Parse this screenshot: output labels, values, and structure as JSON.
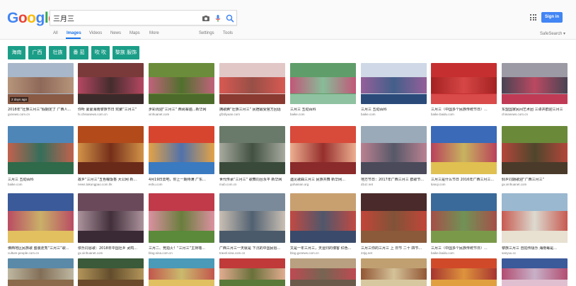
{
  "colors": {
    "brand_blue": "#4285f4",
    "tab_active": "#1a73e8",
    "chip_green": "#1b9e88"
  },
  "logo": {
    "letters": [
      {
        "ch": "G",
        "color": "#4285f4"
      },
      {
        "ch": "o",
        "color": "#ea4335"
      },
      {
        "ch": "o",
        "color": "#fbbc05"
      },
      {
        "ch": "g",
        "color": "#4285f4"
      },
      {
        "ch": "l",
        "color": "#34a853"
      },
      {
        "ch": "e",
        "color": "#ea4335"
      }
    ]
  },
  "search": {
    "value": "三月三",
    "icons": [
      "camera-icon",
      "mic-icon",
      "search-icon"
    ]
  },
  "header": {
    "apps_icon": "apps-grid-icon",
    "signin_label": "Sign in"
  },
  "tabs": [
    {
      "label": "All",
      "active": false
    },
    {
      "label": "Images",
      "active": true
    },
    {
      "label": "Videos",
      "active": false
    },
    {
      "label": "News",
      "active": false
    },
    {
      "label": "Maps",
      "active": false
    },
    {
      "label": "More",
      "active": false
    },
    {
      "label": "Settings",
      "active": false
    },
    {
      "label": "Tools",
      "active": false
    }
  ],
  "safesearch_label": "SafeSearch ▾",
  "chips": [
    "海南",
    "广西",
    "壮族",
    "番 茄",
    "吹 吹",
    "黎族 服饰"
  ],
  "results": [
    {
      "caption": "2018年“壮族三月三”假期定了 广西人...",
      "source": "gxnews.com.cn",
      "age": "2 days ago",
      "colors": [
        "#a8b7c9",
        "#b98f6d",
        "#8a5a45"
      ]
    },
    {
      "caption": "你听 蒙蒙海南黎族节日 欢聚“三月三”",
      "source": "hi.chinanews.com.cn",
      "colors": [
        "#7a3a3a",
        "#c04a6a",
        "#3b2a2a"
      ]
    },
    {
      "caption": "步彩周迎“三月三” 西尚寨遍...新华网",
      "source": "xinhuanet.com",
      "colors": [
        "#6b8c3a",
        "#d05b86",
        "#4c6b2a"
      ]
    },
    {
      "caption": "拥歌腾“壮族三月三” 民宿最受官方回话",
      "source": "gfzdiyuan.com",
      "colors": [
        "#e2c7c7",
        "#d6463e",
        "#8a3a30"
      ]
    },
    {
      "caption": "三月三 五动百科",
      "source": "baike.com",
      "colors": [
        "#5f9e6a",
        "#d34a7a",
        "#8ec2a0"
      ]
    },
    {
      "caption": "三月三 五动百科",
      "source": "baike.com",
      "colors": [
        "#cfd8e6",
        "#8b4a8c",
        "#2a4a7a"
      ]
    },
    {
      "caption": "三月三（中国多个民族传统节日）...",
      "source": "baike.baidu.com",
      "colors": [
        "#c62f2f",
        "#9e1f1f",
        "#d94a4a"
      ]
    },
    {
      "caption": "东盟国家民间艺术团 三卓并群迎三月三",
      "source": "chinanews.com.cn",
      "colors": [
        "#9b9aa5",
        "#3a3545",
        "#c03a55"
      ]
    },
    {
      "caption": "三月三 五动百科",
      "source": "baike.com",
      "colors": [
        "#4f86b8",
        "#d65b3a",
        "#2f6a4a"
      ]
    },
    {
      "caption": "故乡“三月三”五色糯饭香 大公网 新...",
      "source": "news.takungpao.com.hk",
      "colors": [
        "#b34a1a",
        "#d8a050",
        "#6a2a1a"
      ]
    },
    {
      "caption": "4月19日去吧，你上一期待满 广东...",
      "source": "eshu.com",
      "colors": [
        "#d8452f",
        "#e6b34a",
        "#3a7ac0"
      ]
    },
    {
      "caption": "世代传承“三月三” 歌舞同台永平 新华网",
      "source": "mub.com.cn",
      "colors": [
        "#6a7a6a",
        "#b3b3a8",
        "#3a4a3a"
      ]
    },
    {
      "caption": "遇见歌曲三月三 民族共舞 新华网...",
      "source": "gohainan.org",
      "colors": [
        "#d84a3a",
        "#f0c0a0",
        "#8a2a2a"
      ]
    },
    {
      "caption": "地方节日：2017年广西三月三 群歌节...",
      "source": "d1sz.net",
      "colors": [
        "#9aaab8",
        "#c07a8a",
        "#4a4a5a"
      ]
    },
    {
      "caption": "三月三是什么节日 2016年广西三月三...",
      "source": "tianqi.com",
      "colors": [
        "#3a6ab8",
        "#d03a4a",
        "#e0c050"
      ]
    },
    {
      "caption": "侗乡同期歌迎“广西三月三”",
      "source": "gx.xinhuanet.com",
      "colors": [
        "#6a8a3a",
        "#c03a3a",
        "#4a3a2a"
      ]
    },
    {
      "caption": "佛西地区民族歌 盛装走秀“三月三”歌...",
      "source": "culture.people.com.cn",
      "colors": [
        "#3a5a9a",
        "#d04a5a",
        "#e2c060"
      ]
    },
    {
      "caption": "依乐同谷歌：2018年中国壮乡 武鸣...",
      "source": "gx.xinhuanet.com",
      "colors": [
        "#6a4a5a",
        "#b8a0a8",
        "#3a2a35"
      ]
    },
    {
      "caption": "三月二、竞拍火！“三月三”主持墙...",
      "source": "blog.sina.com.cn",
      "colors": [
        "#c03a4a",
        "#e0a0b0",
        "#5a8a3a"
      ]
    },
    {
      "caption": "广西三月三一天就是 下沉的中国民俗...",
      "source": "travel.sina.com.cn",
      "colors": [
        "#7a8a9a",
        "#d8c8b8",
        "#4a5a6a"
      ]
    },
    {
      "caption": "又是一年三月三，天运归的博客  红色...",
      "source": "blog.gxnews.com.cn",
      "colors": [
        "#c8a070",
        "#c03a3a",
        "#3a4a6a"
      ]
    },
    {
      "caption": "三月三你的三月三 上 日节 二十 四节...",
      "source": "24jq.net",
      "colors": [
        "#4a2a2a",
        "#d84a3a",
        "#8a5a3a"
      ]
    },
    {
      "caption": "三月三（中国多个民族传统节日）...",
      "source": "baike.baidu.com",
      "colors": [
        "#3a6a9a",
        "#b84a3a",
        "#7a9a4a"
      ]
    },
    {
      "caption": "黎族三月三 自拍传极乐 海南每是...",
      "source": "sanyuu.cc",
      "colors": [
        "#9ab8d0",
        "#d04a3a",
        "#e8e0d0"
      ]
    },
    {
      "caption": "",
      "source": "",
      "colors": [
        "#5a8aa8",
        "#d0c0a0",
        "#8a6a4a"
      ]
    },
    {
      "caption": "",
      "source": "",
      "colors": [
        "#3a5a3a",
        "#c8a060",
        "#6a4a2a"
      ]
    },
    {
      "caption": "",
      "source": "",
      "colors": [
        "#4a9ab8",
        "#d84a3a",
        "#e0c060"
      ]
    },
    {
      "caption": "",
      "source": "",
      "colors": [
        "#c03a3a",
        "#e8c0a0",
        "#5a7a3a"
      ]
    },
    {
      "caption": "",
      "source": "",
      "colors": [
        "#b8a080",
        "#c03a4a",
        "#6a5a4a"
      ]
    },
    {
      "caption": "",
      "source": "",
      "colors": [
        "#c0a070",
        "#8a4a2a",
        "#d8c8a0"
      ]
    },
    {
      "caption": "",
      "source": "",
      "colors": [
        "#d04a2a",
        "#a03030",
        "#e0a040"
      ]
    },
    {
      "caption": "",
      "source": "",
      "colors": [
        "#3a5a9a",
        "#c84a6a",
        "#e0c0d0"
      ]
    }
  ]
}
